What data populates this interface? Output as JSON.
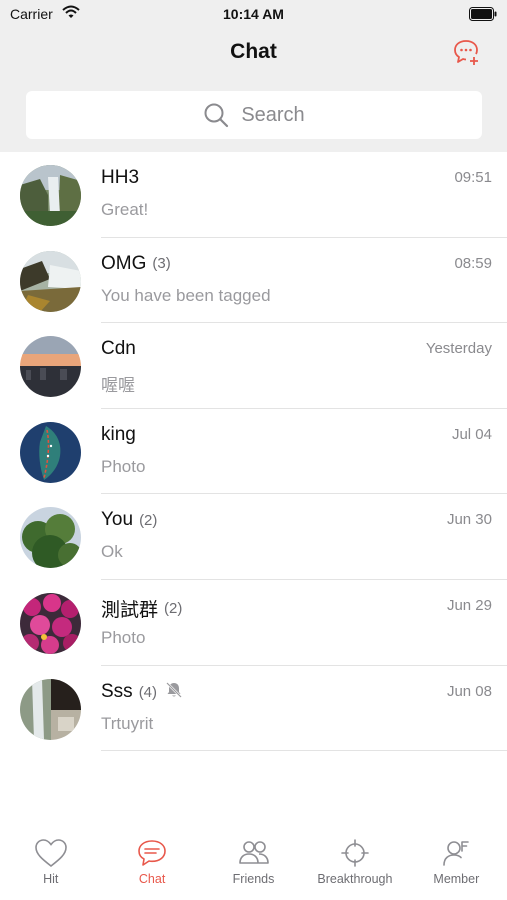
{
  "status_bar": {
    "carrier": "Carrier",
    "time": "10:14 AM"
  },
  "header": {
    "title": "Chat"
  },
  "search": {
    "placeholder": "Search"
  },
  "accent_color": "#e8584b",
  "chats": [
    {
      "name": "HH3",
      "count": "",
      "time": "09:51",
      "preview": "Great!",
      "muted": false
    },
    {
      "name": "OMG",
      "count": "(3)",
      "time": "08:59",
      "preview": "You have been tagged",
      "muted": false
    },
    {
      "name": "Cdn",
      "count": "",
      "time": "Yesterday",
      "preview": "喔喔",
      "muted": false
    },
    {
      "name": "king",
      "count": "",
      "time": "Jul 04",
      "preview": "Photo",
      "muted": false
    },
    {
      "name": "You",
      "count": "(2)",
      "time": "Jun 30",
      "preview": "Ok",
      "muted": false
    },
    {
      "name": "測試群",
      "count": "(2)",
      "time": "Jun 29",
      "preview": "Photo",
      "muted": false
    },
    {
      "name": "Sss",
      "count": "(4)",
      "time": "Jun 08",
      "preview": "Trtuyrit",
      "muted": true
    }
  ],
  "tabs": [
    {
      "label": "Hit",
      "icon": "heart-icon",
      "active": false
    },
    {
      "label": "Chat",
      "icon": "chat-bubble-icon",
      "active": true
    },
    {
      "label": "Friends",
      "icon": "friends-icon",
      "active": false
    },
    {
      "label": "Breakthrough",
      "icon": "crosshair-icon",
      "active": false
    },
    {
      "label": "Member",
      "icon": "member-icon",
      "active": false
    }
  ]
}
